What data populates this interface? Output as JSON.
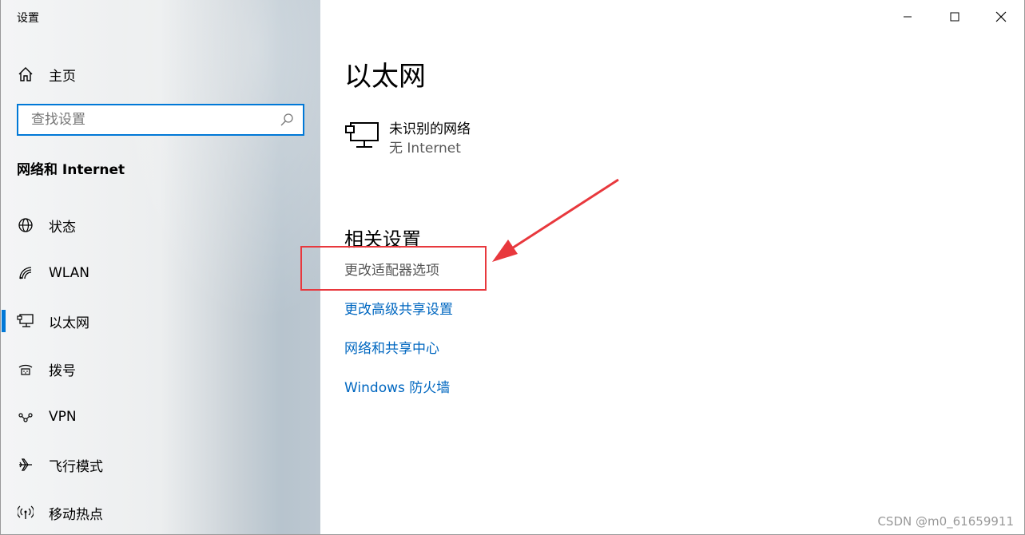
{
  "window": {
    "title": "设置"
  },
  "sidebar": {
    "home_label": "主页",
    "search_placeholder": "查找设置",
    "section_title": "网络和 Internet",
    "items": [
      {
        "label": "状态",
        "icon": "globe-icon"
      },
      {
        "label": "WLAN",
        "icon": "wifi-icon"
      },
      {
        "label": "以太网",
        "icon": "ethernet-icon",
        "active": true
      },
      {
        "label": "拨号",
        "icon": "dialup-icon"
      },
      {
        "label": "VPN",
        "icon": "vpn-icon"
      },
      {
        "label": "飞行模式",
        "icon": "airplane-icon"
      },
      {
        "label": "移动热点",
        "icon": "hotspot-icon"
      }
    ]
  },
  "main": {
    "title": "以太网",
    "network": {
      "name": "未识别的网络",
      "status": "无 Internet"
    },
    "related_title": "相关设置",
    "links": [
      "更改适配器选项",
      "更改高级共享设置",
      "网络和共享中心",
      "Windows 防火墙"
    ]
  },
  "watermark": "CSDN @m0_61659911",
  "colors": {
    "accent": "#0078d7",
    "link": "#0067c0",
    "annotation": "#e8383d"
  }
}
